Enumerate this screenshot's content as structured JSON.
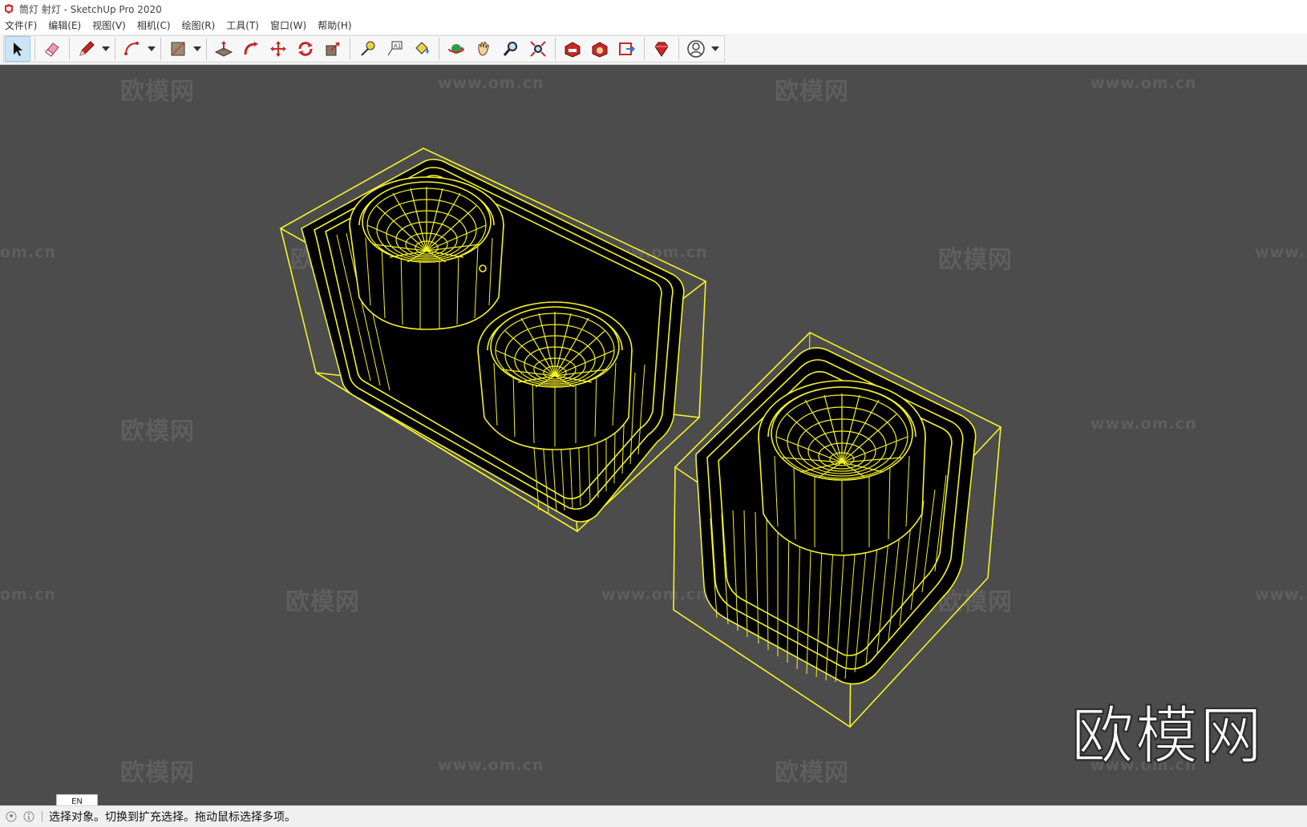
{
  "window": {
    "title": "筒灯 射灯 - SketchUp Pro 2020"
  },
  "menu": [
    "文件(F)",
    "编辑(E)",
    "视图(V)",
    "相机(C)",
    "绘图(R)",
    "工具(T)",
    "窗口(W)",
    "帮助(H)"
  ],
  "watermark": {
    "brand": "欧模网",
    "url": "www.om.cn",
    "url_partial": "om.cn",
    "url_www": "www..."
  },
  "logo": "欧模网",
  "ime": {
    "label": "EN"
  },
  "status": {
    "message": "选择对象。切换到扩充选择。拖动鼠标选择多项。"
  },
  "colors": {
    "viewport_bg": "#4c4c4c",
    "wireframe": "#f5f228",
    "model_fill": "#000000",
    "selection_blue": "#cce4f7"
  }
}
